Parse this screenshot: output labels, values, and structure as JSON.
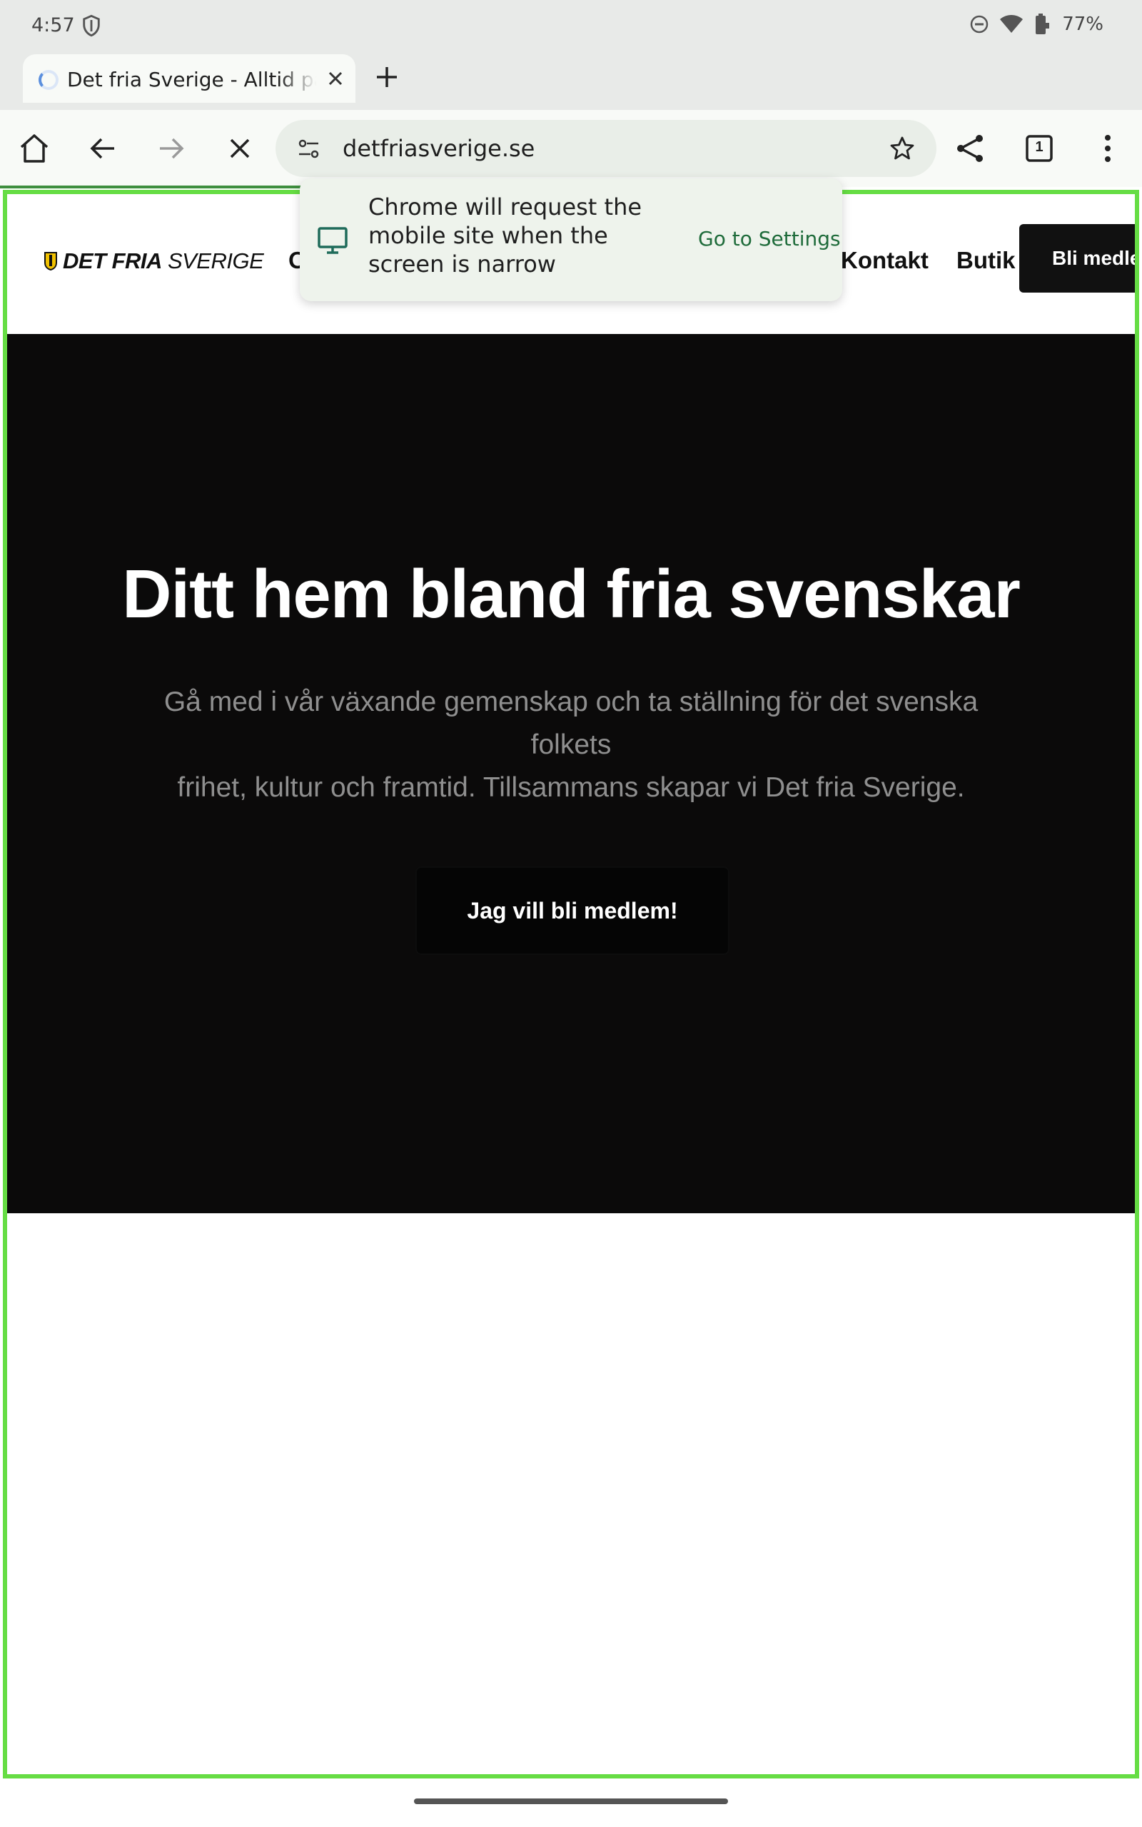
{
  "status_bar": {
    "time": "4:57",
    "battery": "77%",
    "icons": [
      "shield-icon",
      "dnd-icon",
      "wifi-icon",
      "battery-icon"
    ]
  },
  "tab": {
    "title": "Det fria Sverige - Alltid på s",
    "icons": [
      "loading-spinner-icon",
      "close-icon",
      "plus-icon"
    ]
  },
  "toolbar": {
    "url": "detfriasverige.se",
    "tab_count": "1",
    "icons": [
      "home-icon",
      "back-icon",
      "forward-icon",
      "stop-icon",
      "tune-icon",
      "star-icon",
      "share-icon",
      "tabs-icon",
      "more-icon"
    ]
  },
  "popup": {
    "message": "Chrome will request the mobile site when the screen is narrow",
    "link": "Go to Settings",
    "icon": "monitor-icon"
  },
  "site": {
    "logo_bold": "DET FRIA",
    "logo_light": "SVERIGE",
    "nav_partial": "O",
    "nav_contact": "Kontakt",
    "nav_shop": "Butik",
    "nav_cta": "Bli medle"
  },
  "hero": {
    "title": "Ditt hem bland fria svenskar",
    "subtitle_line1": "Gå med i vår växande gemenskap och ta ställning för det svenska",
    "subtitle_line2": "folkets",
    "subtitle_line3": "frihet,  kultur och framtid. Tillsammans skapar vi Det fria Sverige.",
    "button": "Jag vill bli medlem!"
  },
  "colors": {
    "hero_bg": "#0b0a0a",
    "link_green": "#1e6b3a",
    "viewport_border": "#66dd44"
  }
}
